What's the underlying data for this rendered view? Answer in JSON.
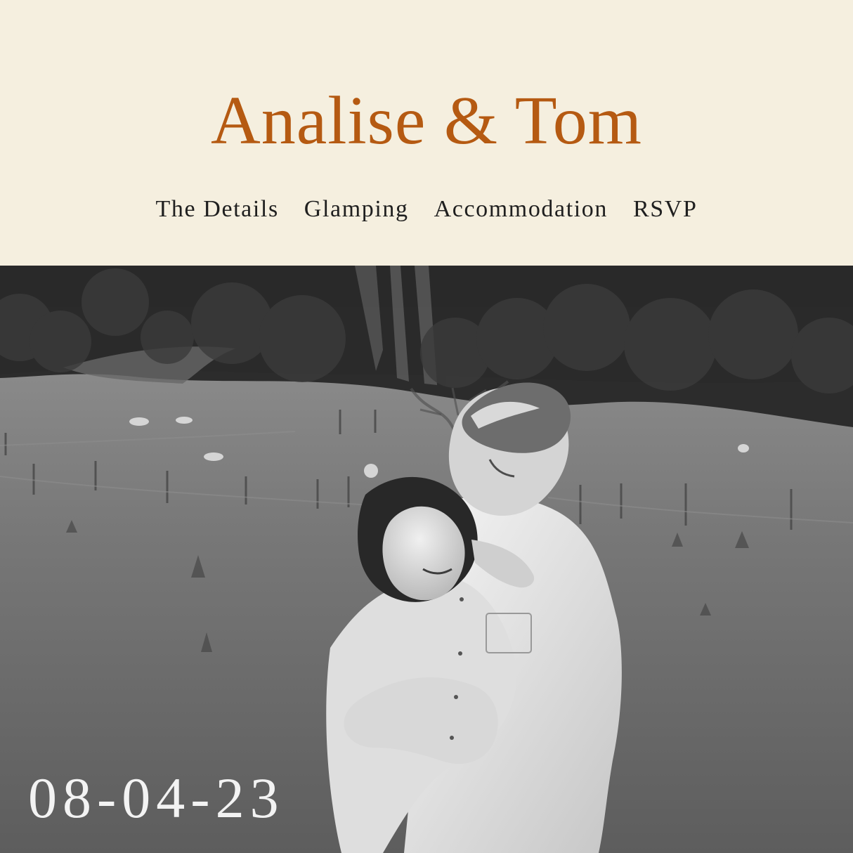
{
  "site": {
    "title": "Analise & Tom",
    "accent": "#b55a12"
  },
  "nav": {
    "items": [
      {
        "label": "The Details"
      },
      {
        "label": "Glamping"
      },
      {
        "label": "Accommodation"
      },
      {
        "label": "RSVP"
      }
    ]
  },
  "hero": {
    "date": "08-04-23"
  }
}
